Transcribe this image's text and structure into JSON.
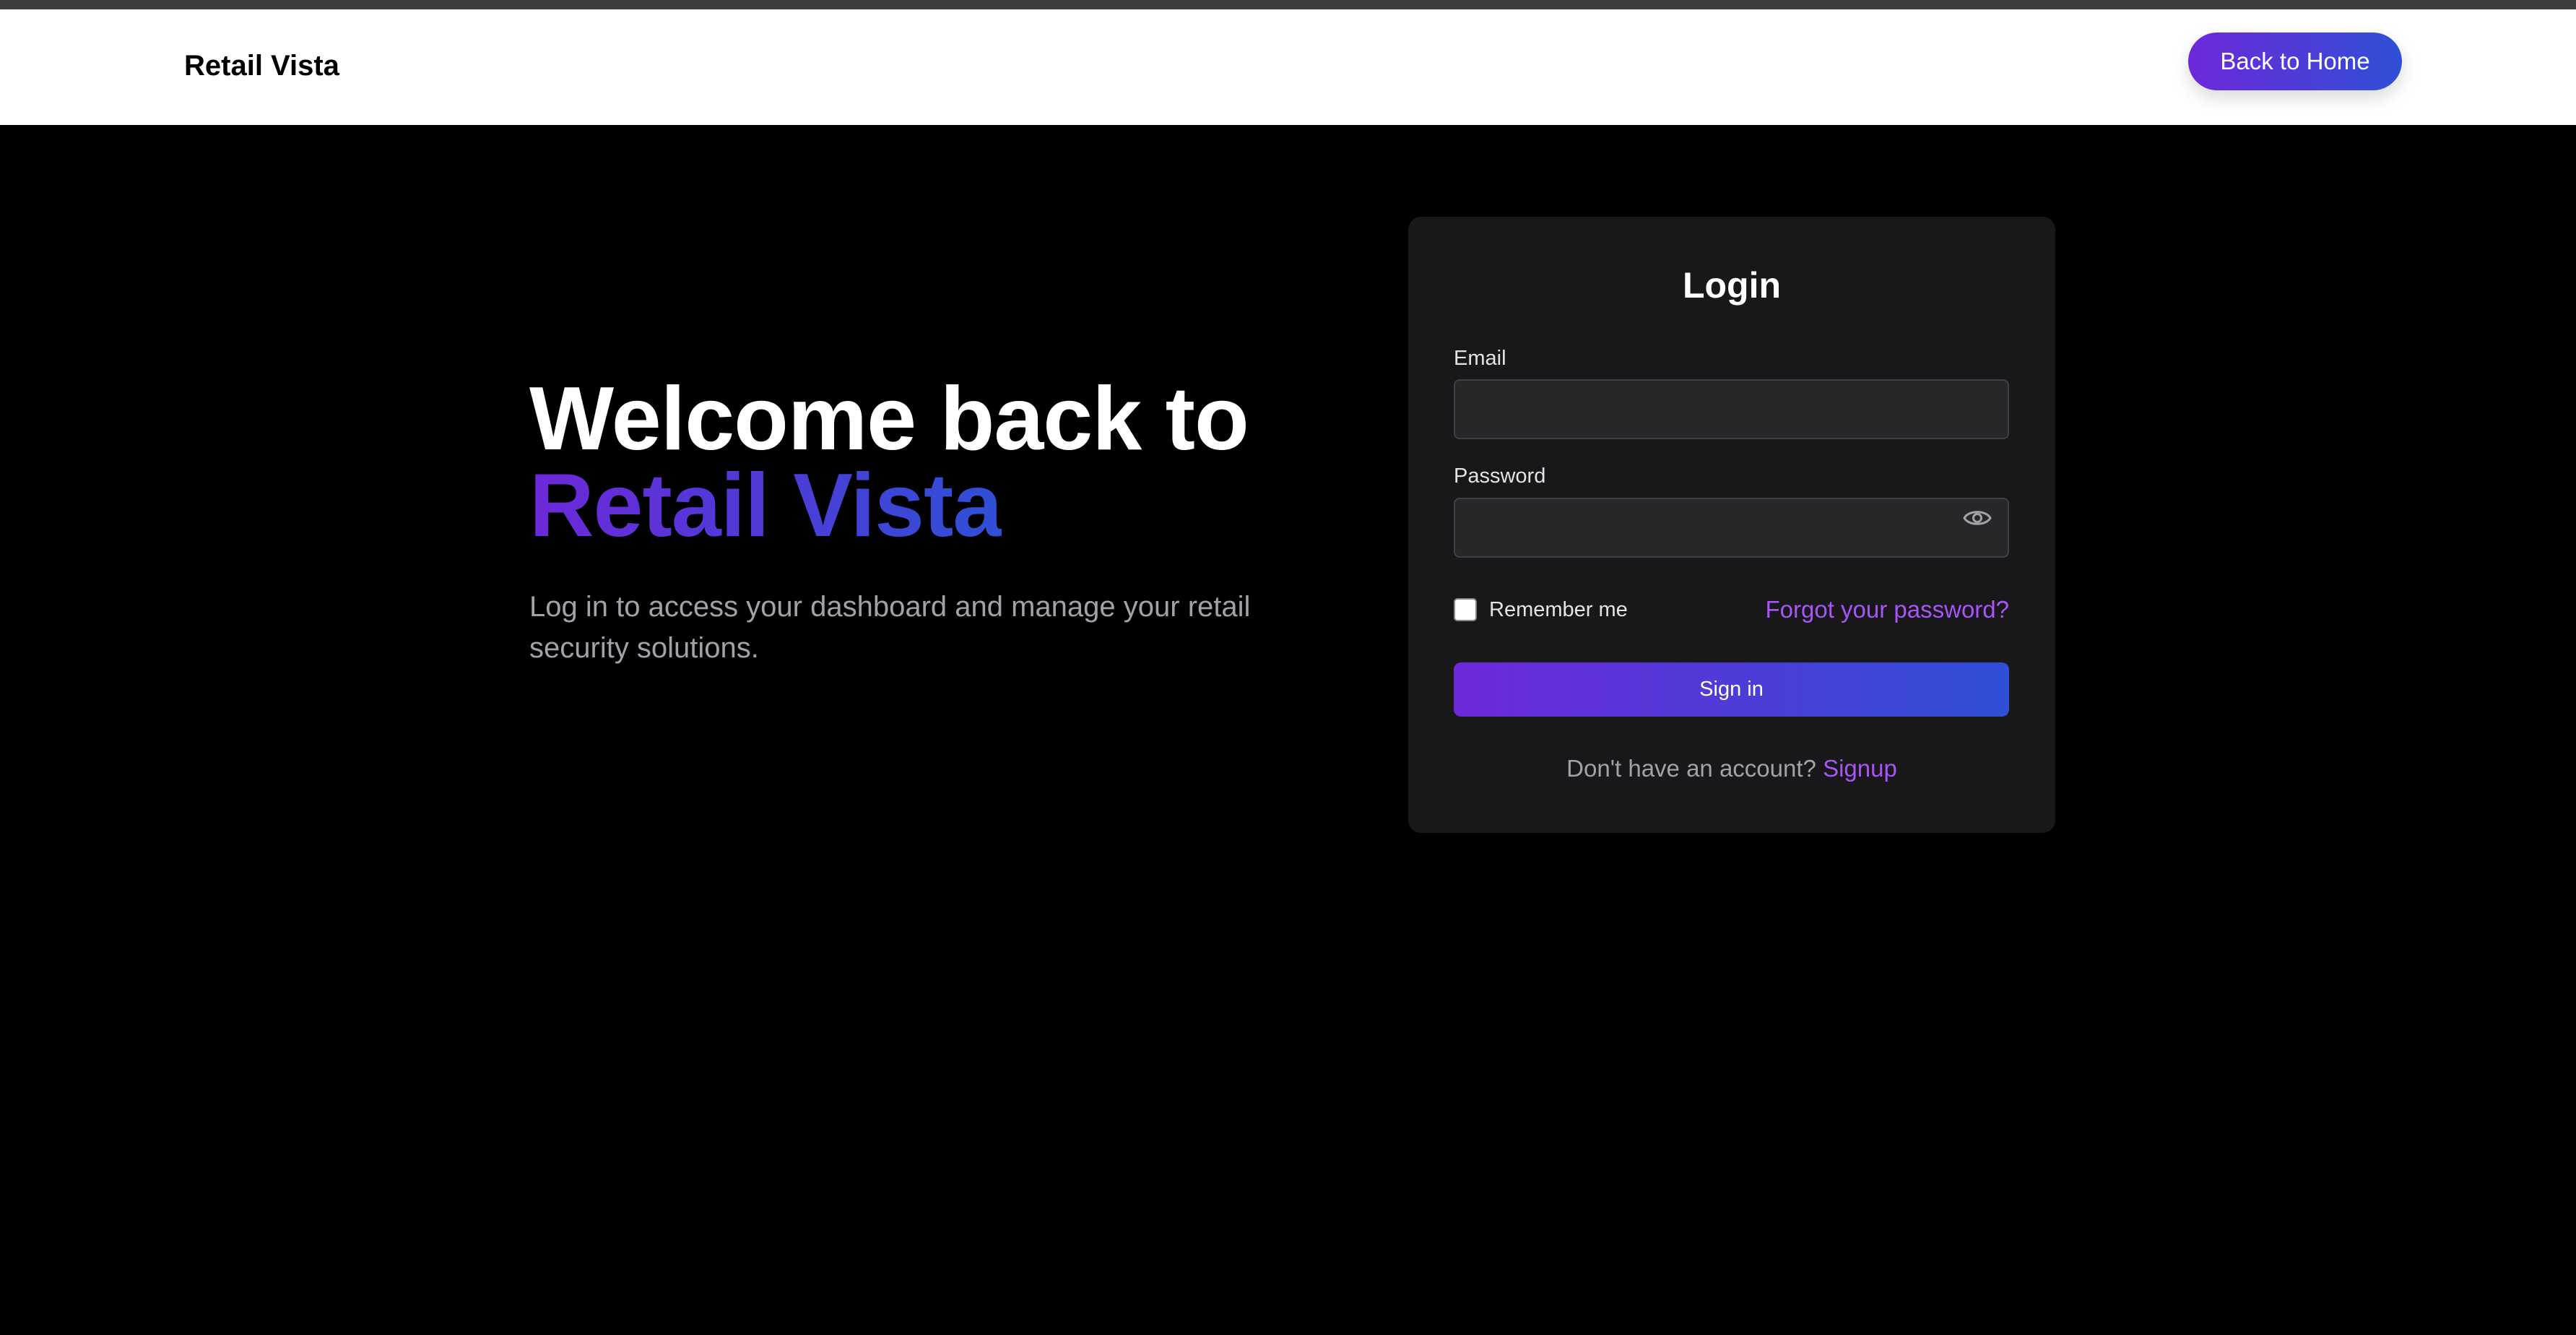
{
  "header": {
    "brand": "Retail Vista",
    "back_label": "Back to Home"
  },
  "hero": {
    "title_line1": "Welcome back to",
    "title_line2": "Retail Vista",
    "subtitle": "Log in to access your dashboard and manage your retail security solutions."
  },
  "login": {
    "title": "Login",
    "email_label": "Email",
    "email_value": "",
    "password_label": "Password",
    "password_value": "",
    "remember_label": "Remember me",
    "remember_checked": false,
    "forgot_label": "Forgot your password?",
    "signin_label": "Sign in",
    "no_account_text": "Don't have an account?",
    "signup_label": "Signup"
  },
  "colors": {
    "accent_start": "#6d28d9",
    "accent_end": "#2f4fd6",
    "link": "#a855f7",
    "card_bg": "#18181b"
  },
  "icons": {
    "password_toggle": "eye-icon"
  }
}
